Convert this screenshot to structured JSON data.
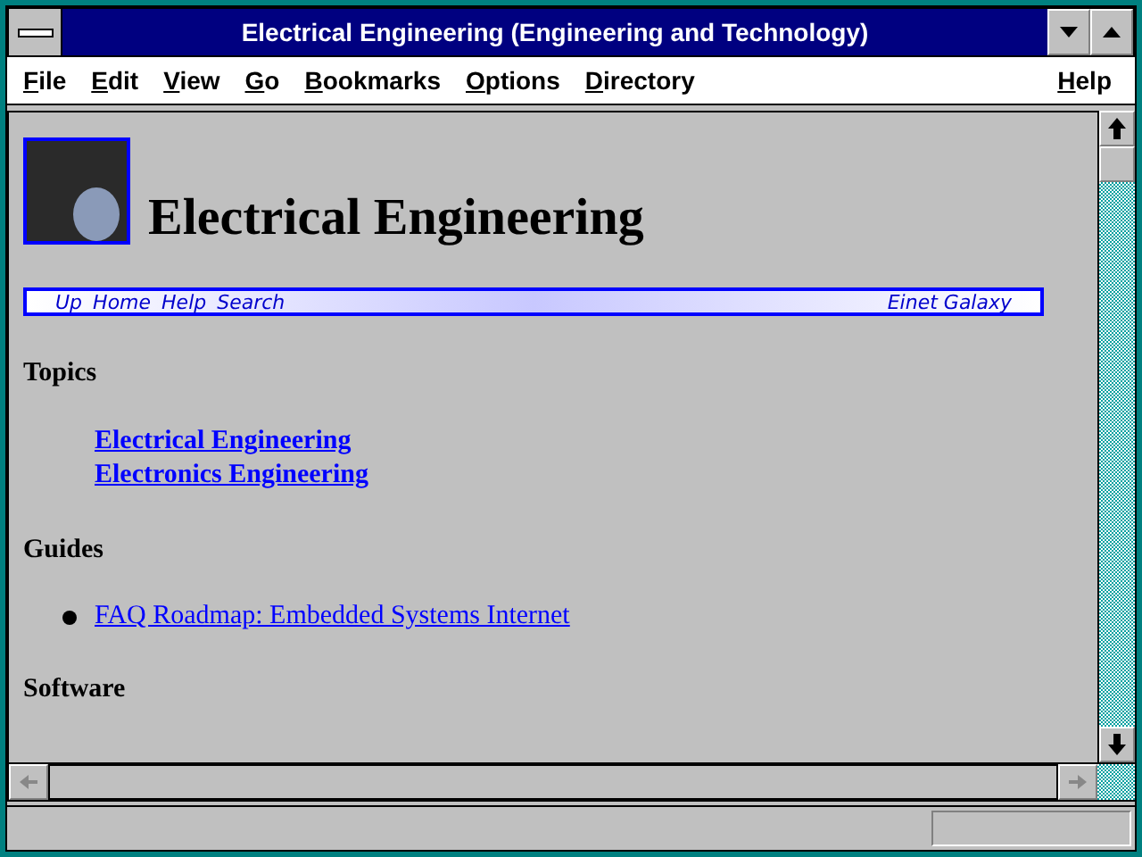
{
  "window": {
    "title": "Electrical Engineering (Engineering and Technology)"
  },
  "menu": [
    {
      "label": "File",
      "kind": "left"
    },
    {
      "label": "Edit",
      "kind": "left"
    },
    {
      "label": "View",
      "kind": "left"
    },
    {
      "label": "Go",
      "kind": "left"
    },
    {
      "label": "Bookmarks",
      "kind": "left"
    },
    {
      "label": "Options",
      "kind": "left"
    },
    {
      "label": "Directory",
      "kind": "left"
    },
    {
      "label": "Help",
      "kind": "right"
    }
  ],
  "page": {
    "heading": "Electrical Engineering",
    "navbar": {
      "links": [
        "Up",
        "Home",
        "Help",
        "Search"
      ],
      "brand": "Einet Galaxy"
    },
    "sections": [
      {
        "heading": "Topics",
        "kind": "plain",
        "items": [
          "Electrical Engineering",
          "Electronics Engineering"
        ]
      },
      {
        "heading": "Guides",
        "kind": "bullet",
        "items": [
          "FAQ Roadmap: Embedded Systems Internet"
        ]
      },
      {
        "heading": "Software",
        "kind": "bullet"
      }
    ]
  }
}
